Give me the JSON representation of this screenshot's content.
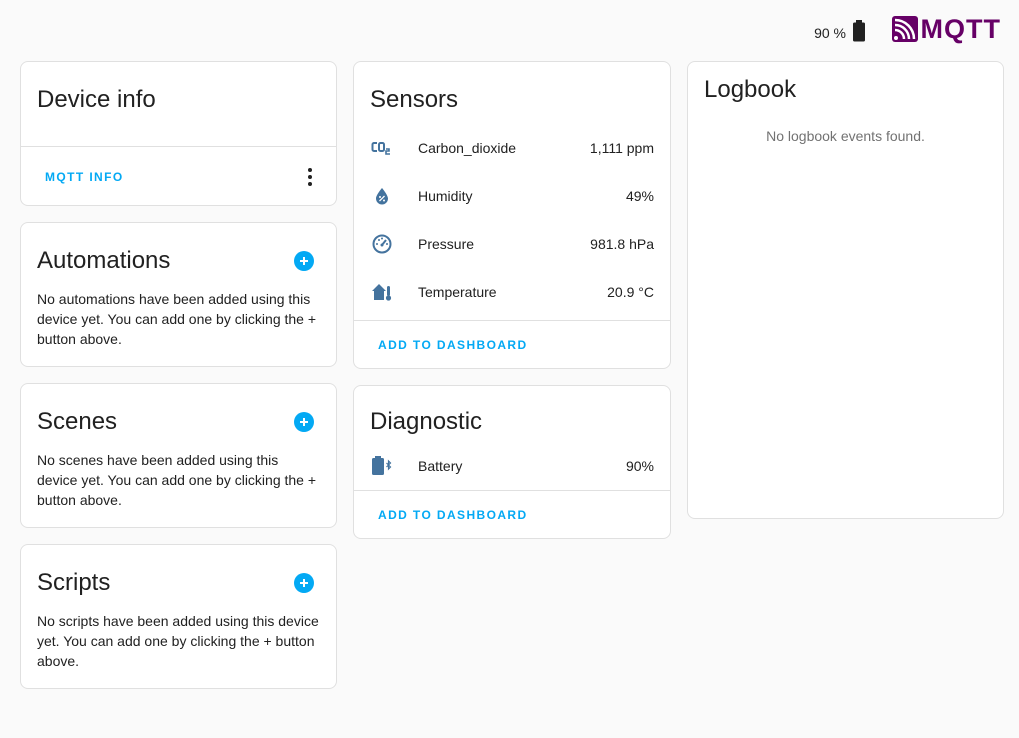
{
  "header": {
    "battery_text": "90 %",
    "logo_text": "MQTT"
  },
  "device_info": {
    "title": "Device info",
    "mqtt_info_label": "MQTT INFO"
  },
  "automations": {
    "title": "Automations",
    "empty_text": "No automations have been added using this device yet. You can add one by clicking the + button above."
  },
  "scenes": {
    "title": "Scenes",
    "empty_text": "No scenes have been added using this device yet. You can add one by clicking the + button above."
  },
  "scripts": {
    "title": "Scripts",
    "empty_text": "No scripts have been added using this device yet. You can add one by clicking the + button above."
  },
  "sensors": {
    "title": "Sensors",
    "items": [
      {
        "name": "Carbon_dioxide",
        "value": "1,111 ppm",
        "icon": "co2-icon"
      },
      {
        "name": "Humidity",
        "value": "49%",
        "icon": "water-percent-icon"
      },
      {
        "name": "Pressure",
        "value": "981.8 hPa",
        "icon": "gauge-icon"
      },
      {
        "name": "Temperature",
        "value": "20.9 °C",
        "icon": "home-thermometer-icon"
      }
    ],
    "add_label": "ADD TO DASHBOARD"
  },
  "diagnostic": {
    "title": "Diagnostic",
    "items": [
      {
        "name": "Battery",
        "value": "90%",
        "icon": "battery-bluetooth-icon"
      }
    ],
    "add_label": "ADD TO DASHBOARD"
  },
  "logbook": {
    "title": "Logbook",
    "empty_text": "No logbook events found."
  },
  "colors": {
    "accent": "#03a9f4",
    "icon": "#44739e",
    "mqtt_brand": "#660066"
  }
}
